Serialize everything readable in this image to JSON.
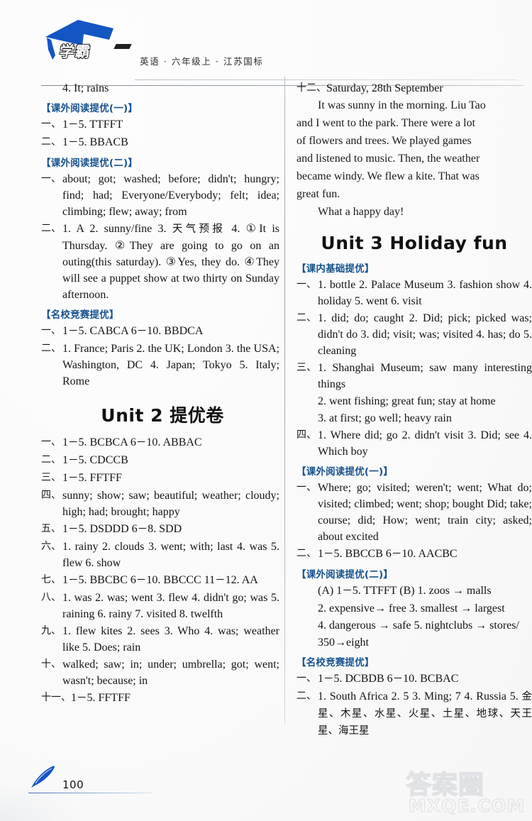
{
  "header": {
    "brand_logo_text": "学霸",
    "title": "英语 · 六年级上 · 江苏国标"
  },
  "left_column": {
    "blocks": [
      {
        "kind": "item",
        "enum": "",
        "text": "4. It; rains",
        "indent": true
      },
      {
        "kind": "section",
        "text": "【课外阅读提优(一)】"
      },
      {
        "kind": "item",
        "enum": "一、",
        "text": "1－5. TTFFT"
      },
      {
        "kind": "item",
        "enum": "二、",
        "text": "1－5. BBACB"
      },
      {
        "kind": "section",
        "text": "【课外阅读提优(二)】"
      },
      {
        "kind": "item",
        "enum": "一、",
        "text": "about; got; washed; before; didn't; hungry; find; had; Everyone/Everybody; felt; idea; climbing; flew; away; from"
      },
      {
        "kind": "item",
        "enum": "二、",
        "text": "1. A   2. sunny/fine   3. 天气预报   4. ①It is Thursday.   ②They are going to go on an outing(this saturday).   ③Yes, they do. ④They will see a puppet show at two thirty on Sunday afternoon."
      },
      {
        "kind": "section",
        "text": "【名校竞赛提优】"
      },
      {
        "kind": "item",
        "enum": "一、",
        "text": "1－5. CABCA   6－10. BBDCA"
      },
      {
        "kind": "item",
        "enum": "二、",
        "text": "1. France; Paris   2. the UK; London   3. the USA; Washington, DC   4. Japan; Tokyo   5. Italy; Rome"
      },
      {
        "kind": "unit",
        "text": "Unit 2  提优卷"
      },
      {
        "kind": "item",
        "enum": "一、",
        "text": "1－5. BCBCA   6－10. ABBAC"
      },
      {
        "kind": "item",
        "enum": "二、",
        "text": "1－5. CDCCB"
      },
      {
        "kind": "item",
        "enum": "三、",
        "text": "1－5. FFTFF"
      },
      {
        "kind": "item",
        "enum": "四、",
        "text": "sunny; show; saw; beautiful; weather; cloudy; high; had; brought; happy"
      },
      {
        "kind": "item",
        "enum": "五、",
        "text": "1－5. DSDDD   6－8. SDD"
      },
      {
        "kind": "item",
        "enum": "六、",
        "text": "1. rainy   2. clouds   3. went; with; last   4. was   5. flew   6. show"
      },
      {
        "kind": "item",
        "enum": "七、",
        "text": "1－5. BBCBC   6－10. BBCCC   11－12. AA"
      },
      {
        "kind": "item",
        "enum": "八、",
        "text": "1. was   2. was; went   3. flew   4. didn't go; was   5. raining   6. rainy   7. visited   8. twelfth"
      },
      {
        "kind": "item",
        "enum": "九、",
        "text": "1. flew kites   2. sees   3. Who   4. was; weather like   5. Does; rain"
      },
      {
        "kind": "item",
        "enum": "十、",
        "text": "walked; saw; in; under; umbrella; got; went; wasn't; because; in"
      },
      {
        "kind": "item",
        "enum": "十一、",
        "text": "1－5. FFTFF"
      }
    ]
  },
  "right_column": {
    "blocks": [
      {
        "kind": "item",
        "enum": "十二、",
        "text": "Saturday, 28th September"
      },
      {
        "kind": "para",
        "text": "It was sunny in the morning. Liu Tao"
      },
      {
        "kind": "para_cont",
        "text": "and I went to the park. There were a lot"
      },
      {
        "kind": "para_cont",
        "text": "of flowers and trees. We played games"
      },
      {
        "kind": "para_cont",
        "text": "and listened to music. Then, the weather"
      },
      {
        "kind": "para_cont",
        "text": "became windy. We flew a kite. That was"
      },
      {
        "kind": "para_cont",
        "text": "great fun."
      },
      {
        "kind": "para",
        "text": "What a happy day!"
      },
      {
        "kind": "unit",
        "text": "Unit 3   Holiday fun"
      },
      {
        "kind": "section",
        "text": "【课内基础提优】"
      },
      {
        "kind": "item",
        "enum": "一、",
        "text": "1. bottle   2. Palace Museum   3. fashion show   4. holiday   5. went   6. visit"
      },
      {
        "kind": "item",
        "enum": "二、",
        "text": "1. did; do; caught   2. Did; pick; picked was; didn't do   3. did; visit; was; visited   4. has; do   5. cleaning"
      },
      {
        "kind": "item",
        "enum": "三、",
        "text": "1. Shanghai Museum; saw many interesting things"
      },
      {
        "kind": "item",
        "enum": "",
        "text": "2. went fishing; great fun; stay at home",
        "indent": true
      },
      {
        "kind": "item",
        "enum": "",
        "text": "3. at first; go well; heavy rain",
        "indent": true
      },
      {
        "kind": "item",
        "enum": "四、",
        "text": "1. Where did; go   2. didn't visit   3. Did; see   4. Which boy"
      },
      {
        "kind": "section",
        "text": "【课外阅读提优(一)】"
      },
      {
        "kind": "item",
        "enum": "一、",
        "text": "Where; go; visited; weren't; went; What do; visited; climbed; went; shop; bought Did; take; course; did; How; went; train city; asked; about  excited"
      },
      {
        "kind": "item",
        "enum": "二、",
        "text": "1－5. BBCCB   6－10. AACBC"
      },
      {
        "kind": "section",
        "text": "【课外阅读提优(二)】"
      },
      {
        "kind": "item",
        "enum": "",
        "text": "(A) 1－5. TTFFT    (B) 1. zoos → malls"
      },
      {
        "kind": "item",
        "enum": "",
        "text": "2. expensive→ free   3. smallest → largest"
      },
      {
        "kind": "item",
        "enum": "",
        "text": "4. dangerous → safe   5. nightclubs → stores/"
      },
      {
        "kind": "item",
        "enum": "",
        "text": "350→eight"
      },
      {
        "kind": "section",
        "text": "【名校竞赛提优】"
      },
      {
        "kind": "item",
        "enum": "一、",
        "text": "1－5. DCBDB   6－10. BCBAC"
      },
      {
        "kind": "item",
        "enum": "二、",
        "text": "1. South Africa   2. 5   3. Ming; 7   4. Russia   5. 金星、木星、水星、火星、土星、地球、天王星、海王星"
      }
    ]
  },
  "footer": {
    "page_number": "100",
    "watermark_cn": "答案圈",
    "watermark_en": "MXQE.COM"
  },
  "colors": {
    "accent_blue": "#17528f",
    "logo_blue": "#1455c4",
    "rule_gray": "#9aa3ad"
  }
}
